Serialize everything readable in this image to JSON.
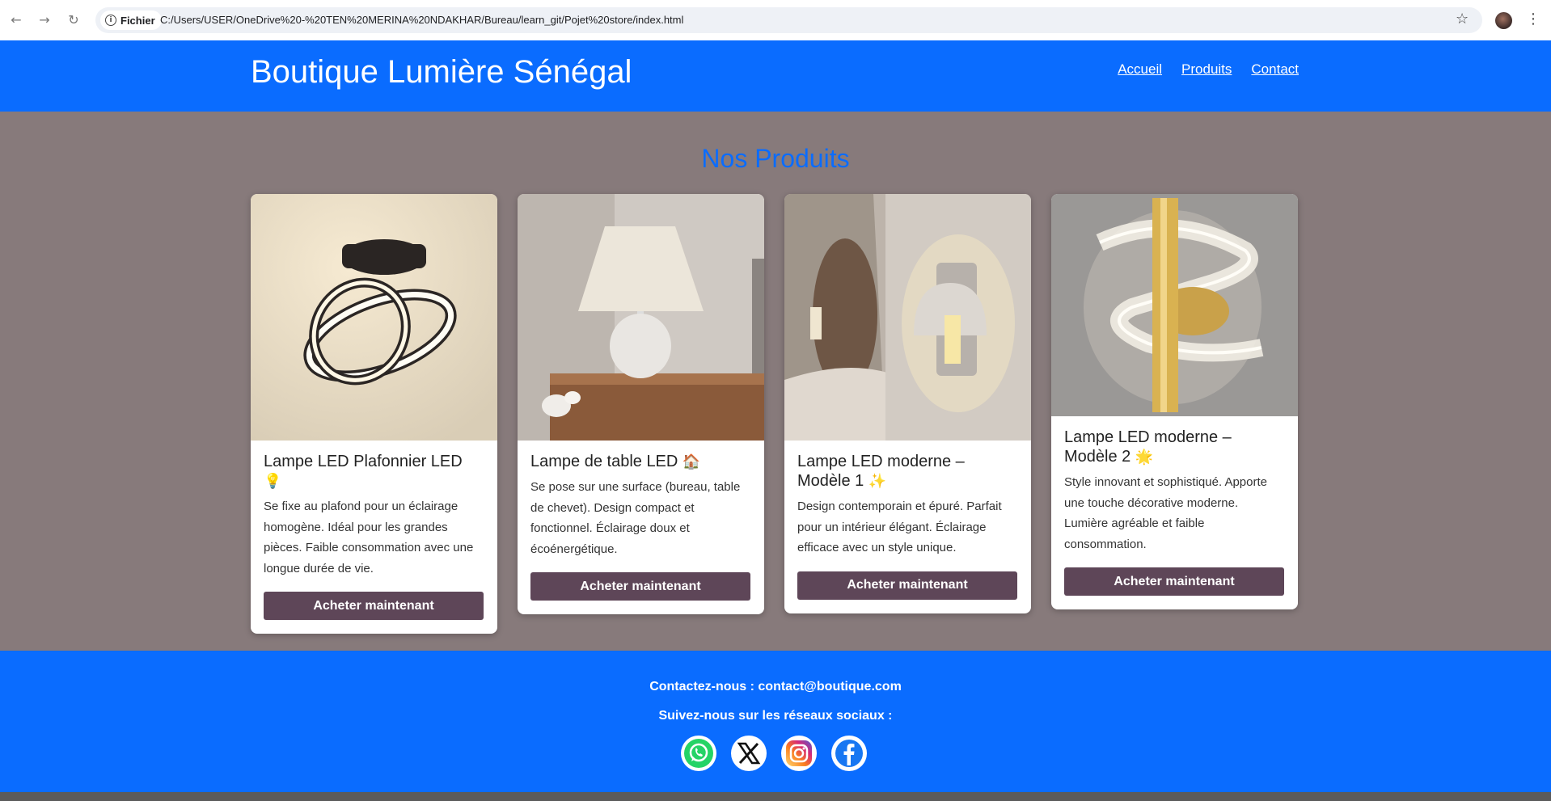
{
  "browser": {
    "site_chip": "Fichier",
    "url": "C:/Users/USER/OneDrive%20-%20TEN%20MERINA%20NDAKHAR/Bureau/learn_git/Pojet%20store/index.html",
    "icons": [
      "back-arrow-icon",
      "forward-arrow-icon",
      "reload-icon",
      "info-icon",
      "star-icon",
      "profile-avatar",
      "kebab-menu-icon"
    ]
  },
  "header": {
    "brand": "Boutique Lumière Sénégal",
    "nav": [
      "Accueil",
      "Produits",
      "Contact"
    ],
    "color": "#0a6cff"
  },
  "main": {
    "title": "Nos Produits",
    "background": "#877a7b"
  },
  "products": [
    {
      "name": "Lampe LED Plafonnier LED",
      "emoji": "💡",
      "description": "Se fixe au plafond pour un éclairage homogène. Idéal pour les grandes pièces. Faible consommation avec une longue durée de vie.",
      "button": "Acheter maintenant"
    },
    {
      "name": "Lampe de table LED",
      "emoji": "🏠",
      "description": "Se pose sur une surface (bureau, table de chevet). Design compact et fonctionnel. Éclairage doux et écoénergétique.",
      "button": "Acheter maintenant"
    },
    {
      "name": "Lampe LED moderne – Modèle 1",
      "emoji": "✨",
      "description": "Design contemporain et épuré. Parfait pour un intérieur élégant. Éclairage efficace avec un style unique.",
      "button": "Acheter maintenant"
    },
    {
      "name": "Lampe LED moderne – Modèle 2",
      "emoji": "🌟",
      "description": "Style innovant et sophistiqué. Apporte une touche décorative moderne. Lumière agréable et faible consommation.",
      "button": "Acheter maintenant"
    }
  ],
  "footer": {
    "contact": "Contactez-nous : contact@boutique.com",
    "follow": "Suivez-nous sur les réseaux sociaux :",
    "socials": [
      "whatsapp-icon",
      "x-icon",
      "instagram-icon",
      "facebook-icon"
    ],
    "button_color": "#5e4658"
  }
}
